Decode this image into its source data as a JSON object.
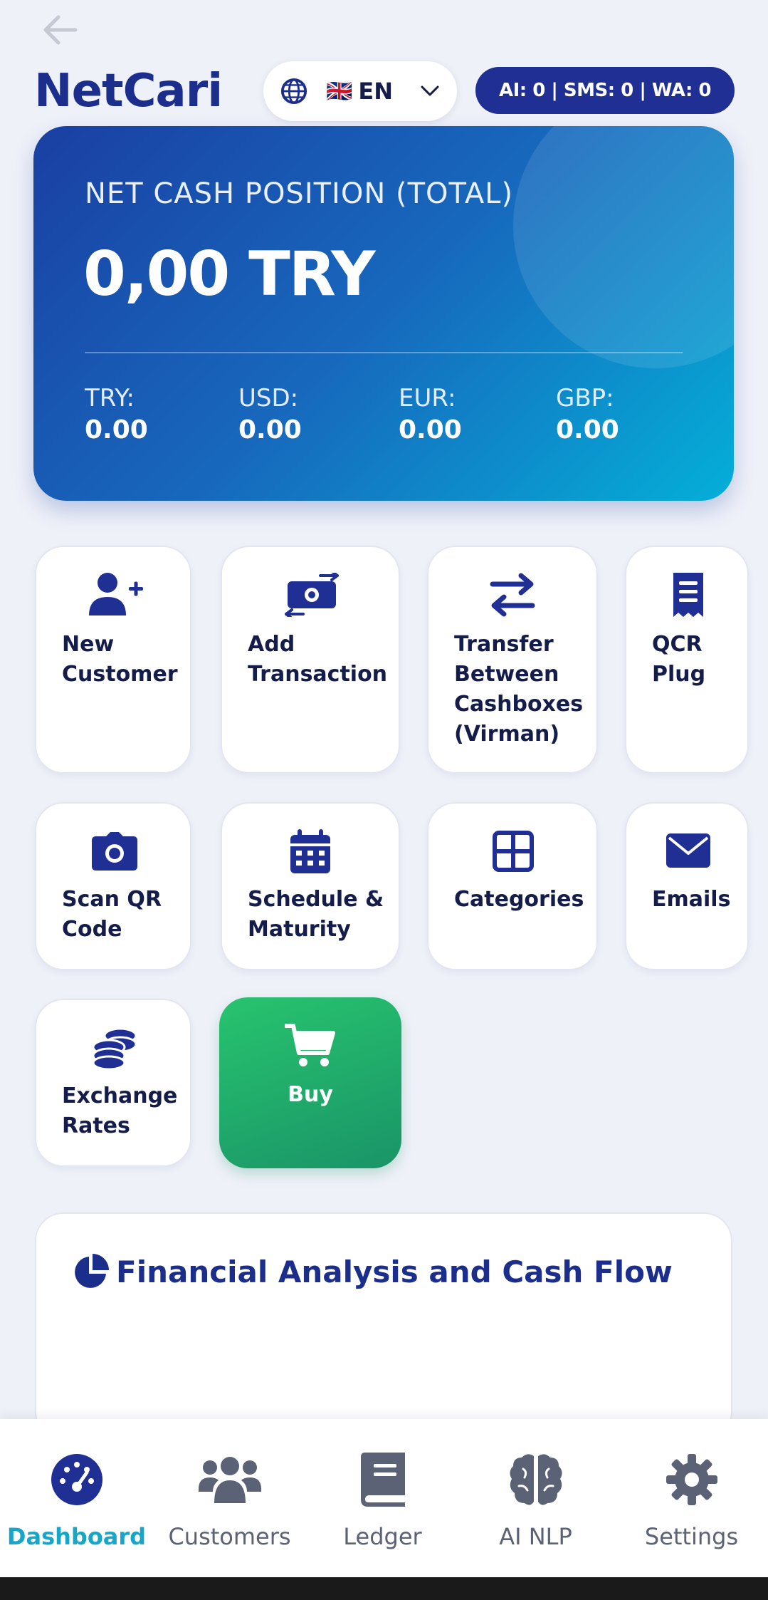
{
  "app": {
    "name": "NetCari",
    "language": {
      "flag": "🇬🇧",
      "code": "EN"
    },
    "quota": "AI: 0 | SMS: 0 | WA: 0"
  },
  "balance": {
    "title": "NET CASH POSITION (TOTAL)",
    "amount": "0,00 TRY",
    "currencies": [
      {
        "label": "TRY:",
        "value": "0.00"
      },
      {
        "label": "USD:",
        "value": "0.00"
      },
      {
        "label": "EUR:",
        "value": "0.00"
      },
      {
        "label": "GBP:",
        "value": "0.00"
      }
    ]
  },
  "actions": [
    {
      "label_line1": "New",
      "label_line2": "Customer",
      "icon": "user-plus-icon"
    },
    {
      "label_line1": "Add",
      "label_line2": "Transaction",
      "icon": "money-exchange-icon"
    },
    {
      "label_line1": "Transfer",
      "label_line2": "Between",
      "label_line3": "Cashboxes",
      "label_line4": "(Virman)",
      "icon": "transfer-arrows-icon"
    },
    {
      "label_line1": "QCR",
      "label_line2": "Plug",
      "icon": "receipt-icon"
    },
    {
      "label_line1": "Scan QR",
      "label_line2": "Code",
      "icon": "camera-icon"
    },
    {
      "label_line1": "Schedule &",
      "label_line2": "Maturity",
      "icon": "calendar-icon"
    },
    {
      "label_line1": "Categories",
      "icon": "grid-icon"
    },
    {
      "label_line1": "Emails",
      "icon": "envelope-icon"
    },
    {
      "label_line1": "Exchange",
      "label_line2": "Rates",
      "icon": "coins-icon"
    },
    {
      "label_line1": "Buy",
      "icon": "shopping-cart-icon"
    }
  ],
  "analysis": {
    "title": "Financial Analysis and Cash Flow",
    "icon": "pie-chart-icon"
  },
  "nav": [
    {
      "label": "Dashboard",
      "icon": "gauge-icon",
      "active": true
    },
    {
      "label": "Customers",
      "icon": "users-icon"
    },
    {
      "label": "Ledger",
      "icon": "book-icon"
    },
    {
      "label": "AI NLP",
      "icon": "brain-icon"
    },
    {
      "label": "Settings",
      "icon": "gear-icon"
    }
  ],
  "colors": {
    "brand": "#1c2e8c",
    "accent": "#17a6c8",
    "buy": "#22b36a",
    "background": "#eff1f9"
  }
}
